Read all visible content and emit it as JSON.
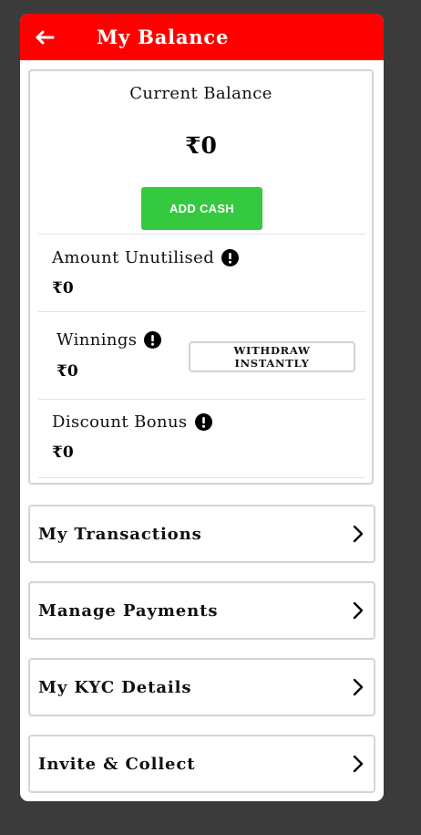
{
  "header": {
    "title": "My Balance",
    "back_icon": "arrow-left-icon",
    "background": "#ff0000"
  },
  "balance": {
    "current_label": "Current Balance",
    "current_amount": "₹0",
    "add_cash_label": "ADD CASH",
    "add_cash_color": "#34c93f",
    "rows": [
      {
        "label": "Amount Unutilised",
        "value": "₹0",
        "icon": "info-icon"
      },
      {
        "label": "Winnings",
        "value": "₹0",
        "icon": "info-icon",
        "action_label": "WITHDRAW INSTANTLY"
      },
      {
        "label": "Discount Bonus",
        "value": "₹0",
        "icon": "info-icon"
      }
    ]
  },
  "menu": [
    {
      "label": "My Transactions",
      "icon": "chevron-right-icon"
    },
    {
      "label": "Manage Payments",
      "icon": "chevron-right-icon"
    },
    {
      "label": "My KYC Details",
      "icon": "chevron-right-icon"
    },
    {
      "label": "Invite & Collect",
      "icon": "chevron-right-icon"
    }
  ]
}
